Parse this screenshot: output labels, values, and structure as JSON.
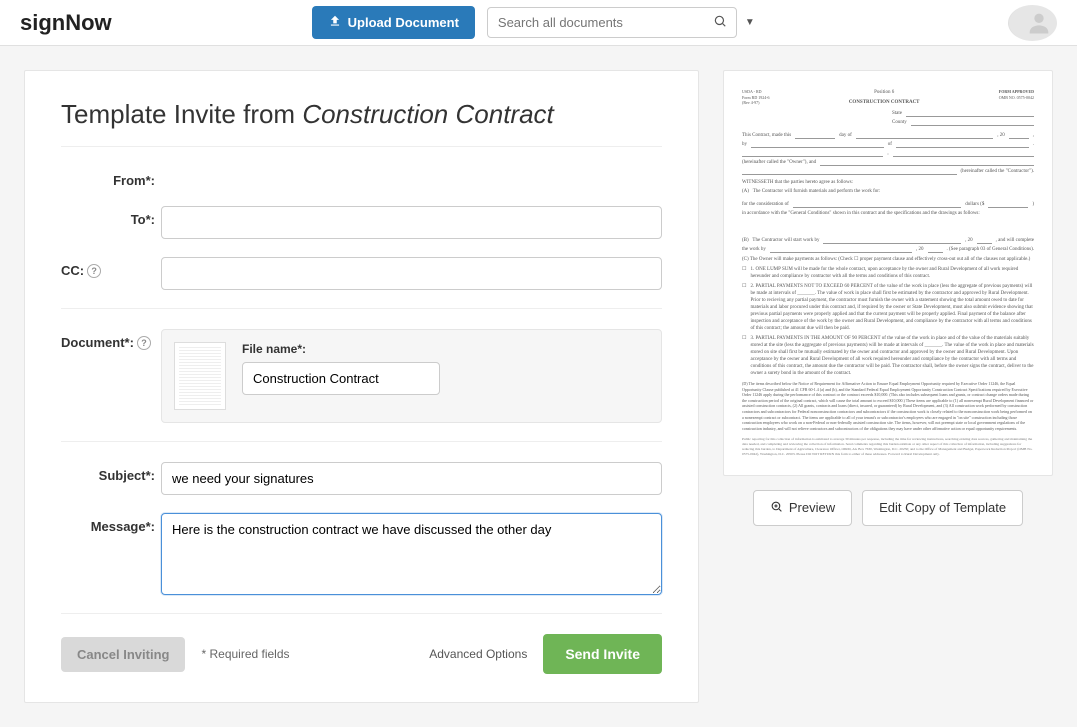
{
  "header": {
    "logo": "signNow",
    "upload_label": "Upload Document",
    "search_placeholder": "Search all documents"
  },
  "page": {
    "title_prefix": "Template Invite from ",
    "title_template": "Construction Contract"
  },
  "form": {
    "from_label": "From*:",
    "to_label": "To*:",
    "cc_label": "CC:",
    "document_label": "Document*:",
    "file_name_label": "File name*:",
    "file_name_value": "Construction Contract",
    "subject_label": "Subject*:",
    "subject_value": "we need your signatures",
    "message_label": "Message*:",
    "message_value": "Here is the construction contract we have discussed the other day"
  },
  "actions": {
    "cancel": "Cancel Inviting",
    "required_note": "* Required fields",
    "advanced": "Advanced Options",
    "send": "Send Invite"
  },
  "preview": {
    "preview_btn": "Preview",
    "edit_btn": "Edit Copy of Template",
    "doc_title": "CONSTRUCTION CONTRACT",
    "position": "Position 6"
  }
}
